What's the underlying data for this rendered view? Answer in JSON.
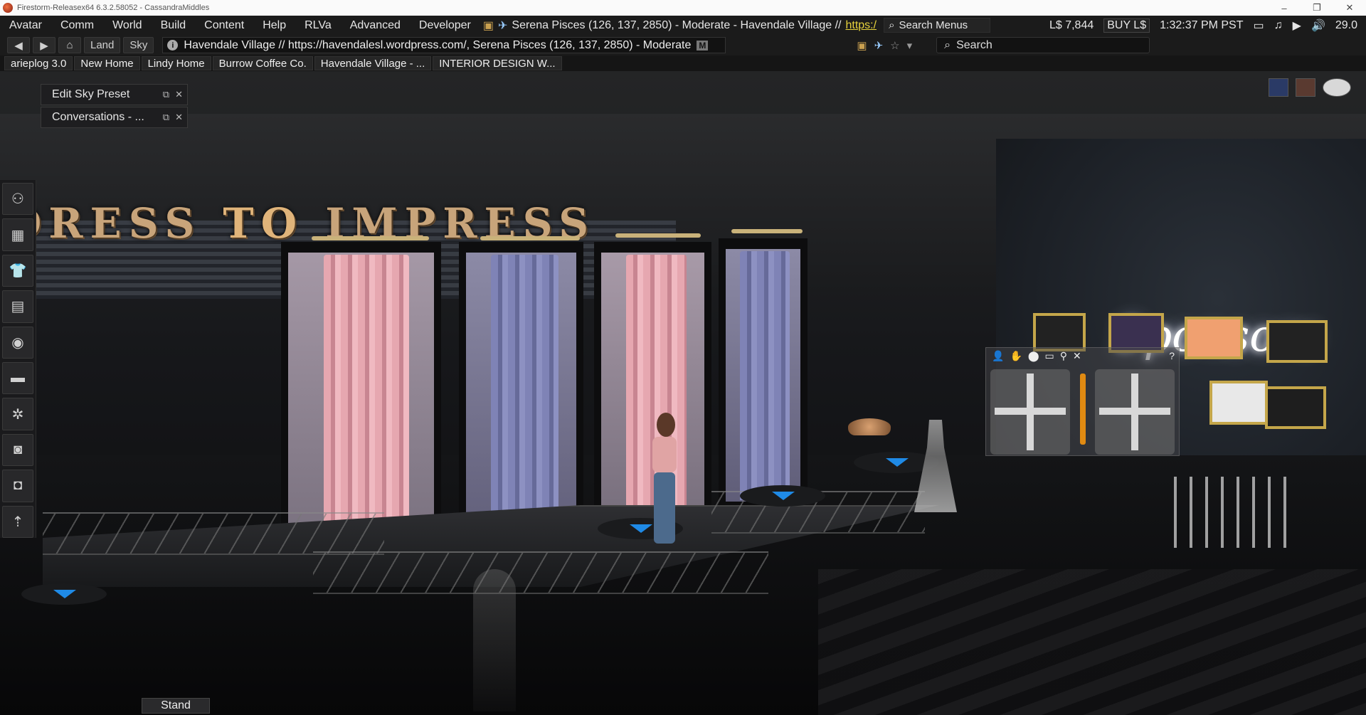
{
  "window": {
    "title": "Firestorm-Releasex64 6.3.2.58052 - CassandraMiddles",
    "controls": [
      "–",
      "❐",
      "✕"
    ]
  },
  "menubar": {
    "items": [
      "Avatar",
      "Comm",
      "World",
      "Build",
      "Content",
      "Help",
      "RLVa",
      "Advanced",
      "Developer"
    ],
    "parcel_info": "Serena Pisces (126, 137, 2850) - Moderate - Havendale Village //",
    "parcel_url": "https:/",
    "search_menus_placeholder": "Search Menus",
    "balance": "L$ 7,844",
    "buy_label": "BUY L$",
    "clock": "1:32:37 PM PST",
    "fps": "29.0"
  },
  "navbar": {
    "land_label": "Land",
    "sky_label": "Sky",
    "location": "Havendale Village // https://havendalesl.wordpress.com/, Serena Pisces (126, 137, 2850) - Moderate",
    "maturity_badge": "M",
    "search_placeholder": "Search"
  },
  "favorites": [
    "arieplog 3.0",
    "New Home",
    "Lindy Home",
    "Burrow Coffee Co.",
    "Havendale Village - ...",
    "INTERIOR DESIGN W..."
  ],
  "floaters": [
    {
      "title": "Edit Sky Preset"
    },
    {
      "title": "Conversations - ..."
    }
  ],
  "toolbar_icons": [
    "people-icon",
    "map-icon",
    "appearance-icon",
    "inventory-icon",
    "search-globe-icon",
    "camera-controls-icon",
    "preferences-icon",
    "snapshot-icon",
    "snapshot-alt-icon",
    "move-icon"
  ],
  "scene": {
    "banner": {
      "part1": "DRESS",
      "part2": "TO",
      "part3": "IMPRESS"
    },
    "sponsors_sign": "Sponsors"
  },
  "movement": {
    "help": "?"
  },
  "stand_label": "Stand"
}
